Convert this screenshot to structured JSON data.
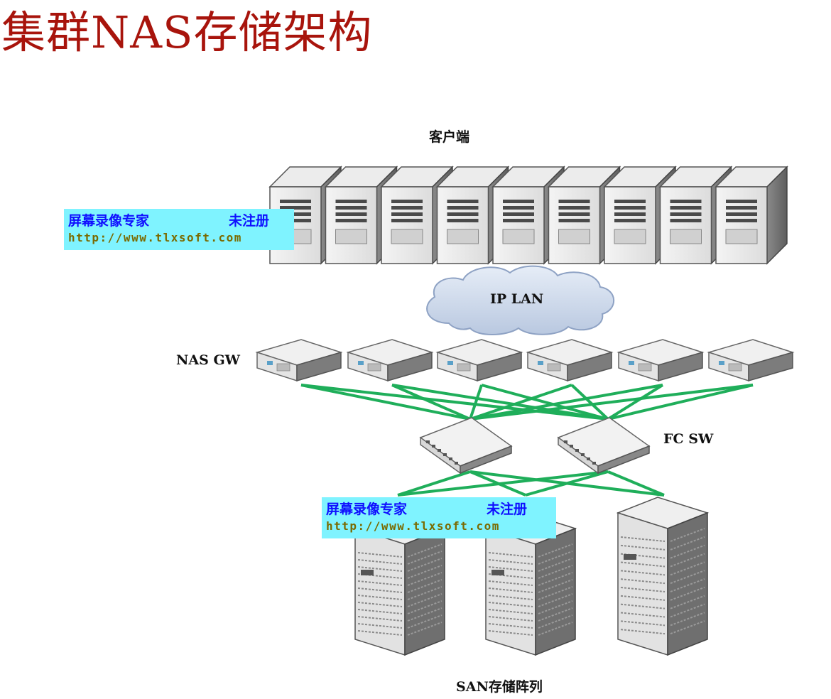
{
  "title": "集群NAS存储架构",
  "labels": {
    "clients": "客户端",
    "lan": "IP LAN",
    "nas_gw": "NAS GW",
    "fc_sw": "FC SW",
    "san": "SAN存储阵列"
  },
  "watermark": {
    "line1": "屏幕录像专家",
    "line1b": "未注册",
    "line2": "http://www.tlxsoft.com"
  },
  "colors": {
    "title": "#a8140c",
    "link": "#1fae5a",
    "watermark_bg": "#7ff3ff",
    "watermark_text": "#1010ff",
    "cloud": "#c9d6ea"
  },
  "counts": {
    "clients": 9,
    "gateways": 6,
    "switches": 2,
    "arrays": 3
  }
}
